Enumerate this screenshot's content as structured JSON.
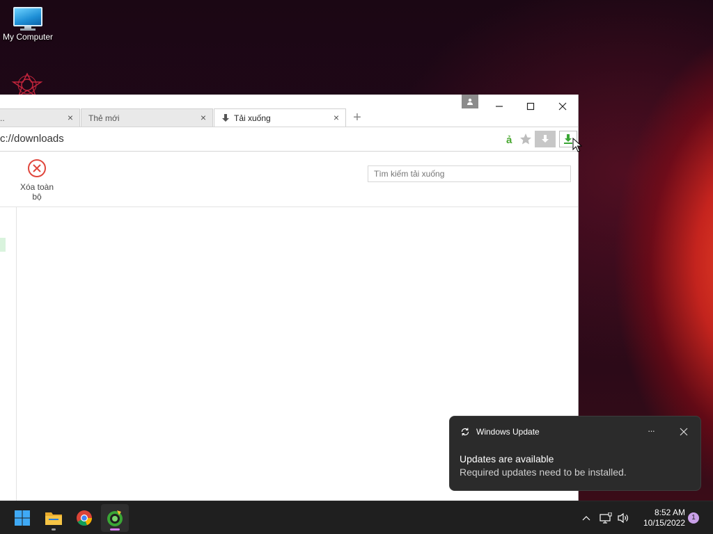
{
  "desktop": {
    "icons": [
      {
        "label": "My Computer",
        "icon": "monitor-icon"
      },
      {
        "label": "",
        "icon": "star-logo-icon"
      }
    ]
  },
  "browser": {
    "tabs": [
      {
        "label": "..",
        "active": false
      },
      {
        "label": "Thẻ mới",
        "active": false
      },
      {
        "label": "Tải xuống",
        "active": true,
        "icon": "download-arrow-icon"
      }
    ],
    "new_tab_symbol": "+",
    "window_controls": {
      "minimize": "minimize-icon",
      "maximize": "maximize-icon",
      "close": "close-icon"
    },
    "address": {
      "url": "c://downloads"
    },
    "address_icons": [
      "coccoc-a-icon",
      "bookmark-star-icon",
      "download-page-icon",
      "download-manager-icon"
    ],
    "downloads": {
      "clear_all_label": "Xóa toàn bộ",
      "search_placeholder": "Tìm kiếm tải xuống"
    }
  },
  "notification": {
    "app_name": "Windows Update",
    "title": "Updates are available",
    "body": "Required updates need to be installed.",
    "more_symbol": "···"
  },
  "taskbar": {
    "apps": [
      "windows-start-icon",
      "file-explorer-icon",
      "chrome-icon",
      "coccoc-browser-icon"
    ],
    "clock": {
      "time": "8:52 AM",
      "date": "10/15/2022"
    },
    "notification_count": "1"
  },
  "colors": {
    "accent_green": "#3aa635",
    "clear_red": "#e0463c",
    "taskbar_bg": "#1f1f1f"
  }
}
